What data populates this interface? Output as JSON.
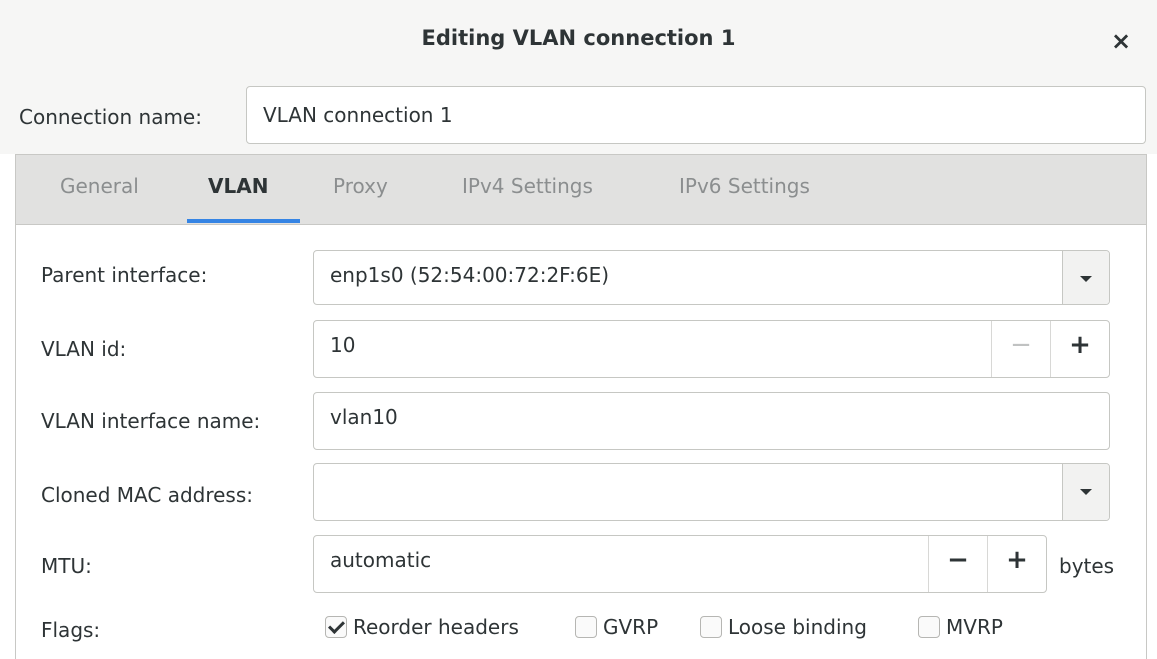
{
  "window": {
    "title": "Editing VLAN connection 1",
    "close_glyph": "×"
  },
  "connection": {
    "label": "Connection name:",
    "value": "VLAN connection 1"
  },
  "tabs": [
    {
      "label": "General",
      "active": false
    },
    {
      "label": "VLAN",
      "active": true
    },
    {
      "label": "Proxy",
      "active": false
    },
    {
      "label": "IPv4 Settings",
      "active": false
    },
    {
      "label": "IPv6 Settings",
      "active": false
    }
  ],
  "form": {
    "parent_interface": {
      "label": "Parent interface:",
      "value": "enp1s0 (52:54:00:72:2F:6E)"
    },
    "vlan_id": {
      "label": "VLAN id:",
      "value": "10",
      "minus": "−",
      "plus": "+"
    },
    "vlan_interface_name": {
      "label": "VLAN interface name:",
      "value": "vlan10"
    },
    "cloned_mac": {
      "label": "Cloned MAC address:",
      "value": ""
    },
    "mtu": {
      "label": "MTU:",
      "value": "automatic",
      "minus": "−",
      "plus": "+",
      "unit": "bytes"
    },
    "flags": {
      "label": "Flags:",
      "options": [
        {
          "label": "Reorder headers",
          "checked": true
        },
        {
          "label": "GVRP",
          "checked": false
        },
        {
          "label": "Loose binding",
          "checked": false
        },
        {
          "label": "MVRP",
          "checked": false
        }
      ]
    }
  },
  "colors": {
    "accent": "#3584e4",
    "header_bg": "#f6f6f5",
    "tabbar_bg": "#e1e1e0"
  }
}
